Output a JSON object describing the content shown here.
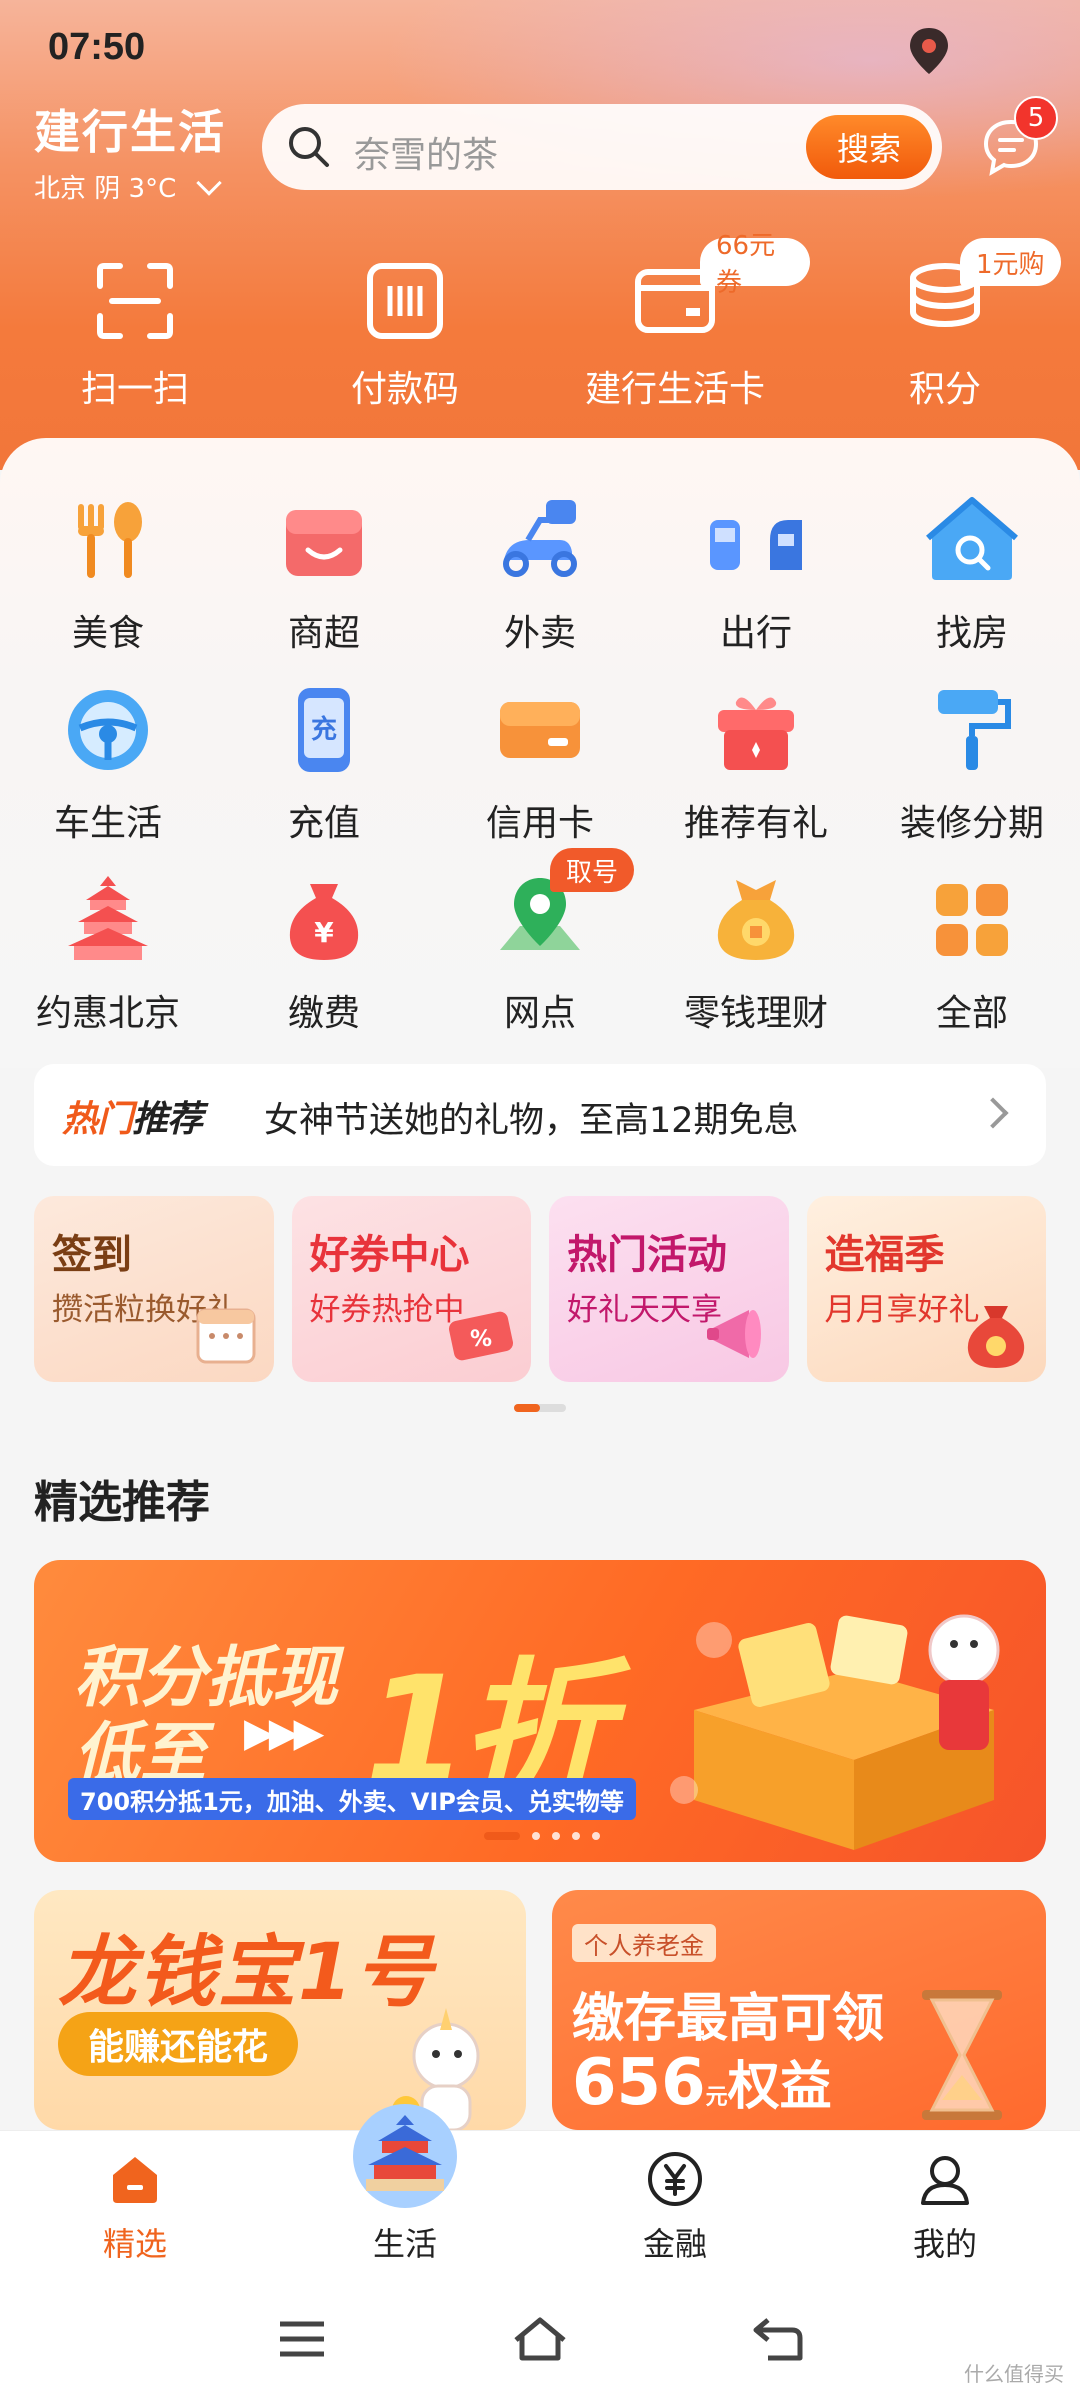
{
  "status_bar": {
    "time": "07:50"
  },
  "header": {
    "brand": "建行生活",
    "weather": "北京 阴 3°C",
    "search": {
      "placeholder": "奈雪的茶",
      "button": "搜索"
    },
    "messages_badge": "5"
  },
  "quick_actions": [
    {
      "label": "扫一扫",
      "icon": "scan-icon"
    },
    {
      "label": "付款码",
      "icon": "barcode-icon"
    },
    {
      "label": "建行生活卡",
      "icon": "card-icon",
      "tag": "66元券"
    },
    {
      "label": "积分",
      "icon": "coins-icon",
      "tag": "1元购"
    }
  ],
  "services": [
    {
      "label": "美食",
      "icon": "food-icon"
    },
    {
      "label": "商超",
      "icon": "store-icon"
    },
    {
      "label": "外卖",
      "icon": "delivery-icon"
    },
    {
      "label": "出行",
      "icon": "transit-icon"
    },
    {
      "label": "找房",
      "icon": "house-icon"
    },
    {
      "label": "车生活",
      "icon": "steering-wheel-icon"
    },
    {
      "label": "充值",
      "icon": "phone-topup-icon"
    },
    {
      "label": "信用卡",
      "icon": "credit-card-icon"
    },
    {
      "label": "推荐有礼",
      "icon": "gift-icon"
    },
    {
      "label": "装修分期",
      "icon": "paint-roller-icon"
    },
    {
      "label": "约惠北京",
      "icon": "temple-icon"
    },
    {
      "label": "缴费",
      "icon": "money-bag-icon"
    },
    {
      "label": "网点",
      "icon": "branch-location-icon",
      "tag": "取号"
    },
    {
      "label": "零钱理财",
      "icon": "wealth-icon"
    },
    {
      "label": "全部",
      "icon": "all-apps-icon"
    }
  ],
  "promo": {
    "tag_a": "热门",
    "tag_b": "推荐",
    "text": "女神节送她的礼物，至高12期免息"
  },
  "feature_cards": [
    {
      "title": "签到",
      "subtitle": "攒活粒换好礼",
      "bg": "#fde4d2",
      "title_color": "#7a3e14",
      "sub_color": "#9a5a2e"
    },
    {
      "title": "好券中心",
      "subtitle": "好券热抢中",
      "bg": "#fbd9dc",
      "title_color": "#e8333b",
      "sub_color": "#e8333b"
    },
    {
      "title": "热门活动",
      "subtitle": "好礼天天享",
      "bg": "#f9d2ea",
      "title_color": "#c2186b",
      "sub_color": "#c2186b"
    },
    {
      "title": "造福季",
      "subtitle": "月月享好礼",
      "bg": "#fde2c8",
      "title_color": "#e2372d",
      "sub_color": "#e2372d"
    }
  ],
  "section_title": "精选推荐",
  "banner": {
    "line1": "积分抵现",
    "line2": "低至",
    "big": "1折",
    "note": "700积分抵1元，加油、外卖、VIP会员、兑实物等"
  },
  "bottom_cards": {
    "left": {
      "title": "龙钱宝1号",
      "pill": "能赚还能花"
    },
    "right": {
      "tag": "个人养老金",
      "line1": "缴存最高可领",
      "amount": "656",
      "unit": "元",
      "suffix": "权益"
    }
  },
  "tabs": [
    {
      "label": "精选",
      "icon": "home-icon",
      "active": true
    },
    {
      "label": "生活",
      "icon": "temple-icon",
      "active": false
    },
    {
      "label": "金融",
      "icon": "yuan-icon",
      "active": false
    },
    {
      "label": "我的",
      "icon": "user-icon",
      "active": false
    }
  ],
  "watermark": "什么值得买",
  "colors": {
    "accent": "#f0641e",
    "header_top": "#f6b49a",
    "header_bottom": "#f2763a"
  }
}
